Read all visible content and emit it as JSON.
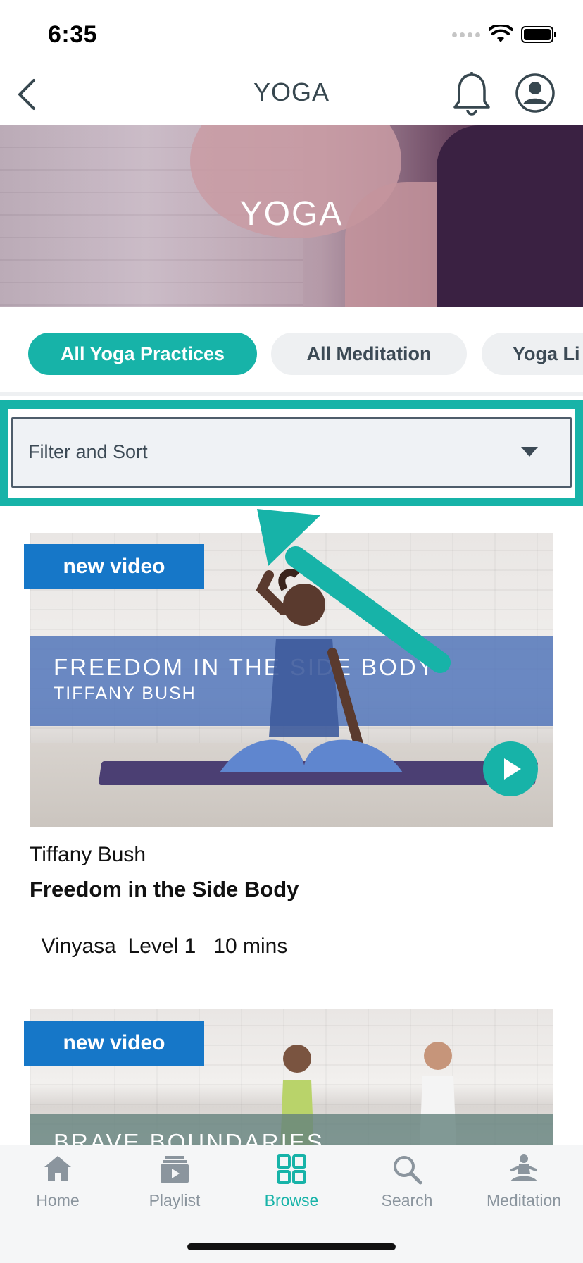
{
  "status_bar": {
    "time": "6:35"
  },
  "nav": {
    "title": "YOGA",
    "back_icon": "chevron-left-icon",
    "bell_icon": "bell-icon",
    "profile_icon": "user-circle-icon"
  },
  "hero": {
    "title": "YOGA"
  },
  "tabs": [
    {
      "label": "All Yoga Practices",
      "active": true
    },
    {
      "label": "All Meditation",
      "active": false
    },
    {
      "label": "Yoga Li",
      "active": false
    }
  ],
  "filter": {
    "label": "Filter and Sort"
  },
  "cards": [
    {
      "badge": "new video",
      "banner_title": "FREEDOM IN THE SIDE BODY",
      "banner_subtitle": "TIFFANY BUSH",
      "instructor": "Tiffany Bush",
      "title": "Freedom in the Side Body",
      "style": "Vinyasa",
      "level": "Level 1",
      "duration": "10 mins"
    },
    {
      "badge": "new video",
      "banner_title": "BRAVE BOUNDARIES"
    }
  ],
  "bottom_tabs": [
    {
      "label": "Home",
      "icon": "home-icon",
      "active": false
    },
    {
      "label": "Playlist",
      "icon": "playlist-icon",
      "active": false
    },
    {
      "label": "Browse",
      "icon": "grid-icon",
      "active": true
    },
    {
      "label": "Search",
      "icon": "search-icon",
      "active": false
    },
    {
      "label": "Meditation",
      "icon": "meditation-icon",
      "active": false
    }
  ],
  "colors": {
    "accent": "#17b3a8",
    "badge": "#1677c8",
    "title_gray": "#37474f",
    "tab_inactive": "#8b959e"
  }
}
